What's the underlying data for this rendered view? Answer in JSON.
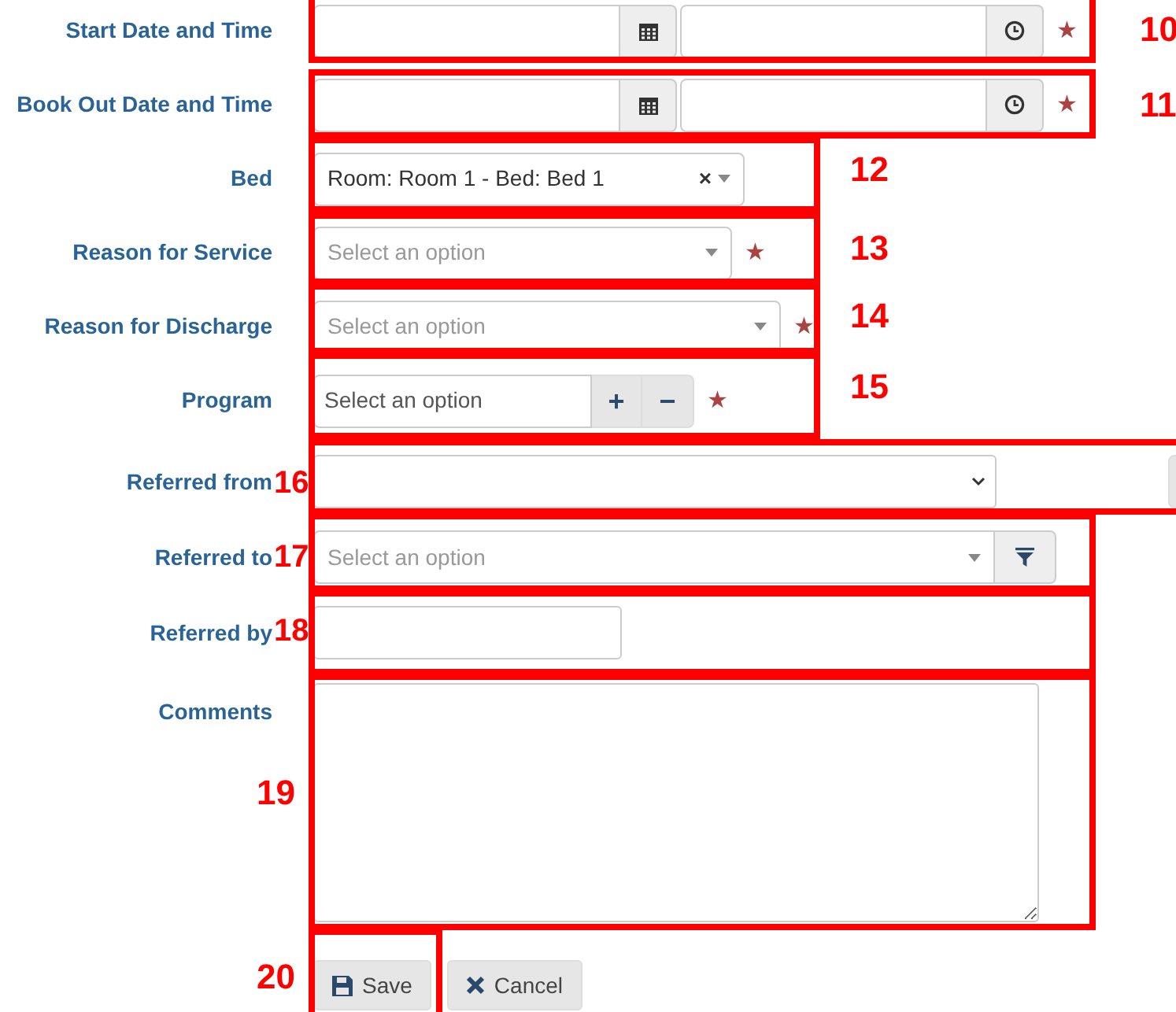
{
  "fields": [
    {
      "kind": "datetime",
      "label": "Start Date and Time",
      "required_mark": "★"
    },
    {
      "kind": "datetime",
      "label": "Book Out Date and Time",
      "required_mark": "★"
    },
    {
      "kind": "select",
      "label": "Bed",
      "value": "Room: Room 1 - Bed: Bed 1",
      "clear": "×"
    },
    {
      "kind": "select",
      "label": "Reason for Service",
      "placeholder": "Select an option",
      "required_mark": "★"
    },
    {
      "kind": "select",
      "label": "Reason for Discharge",
      "placeholder": "Select an option",
      "required_mark": "★"
    },
    {
      "kind": "program",
      "label": "Program",
      "placeholder": "Select an option",
      "add": "+",
      "remove": "−",
      "required_mark": "★"
    },
    {
      "kind": "native",
      "label": "Referred from"
    },
    {
      "kind": "filter",
      "label": "Referred to",
      "placeholder": "Select an option"
    },
    {
      "kind": "text",
      "label": "Referred by"
    },
    {
      "kind": "textarea",
      "label": "Comments"
    }
  ],
  "buttons": [
    {
      "kind": "save",
      "label": "Save"
    },
    {
      "kind": "cancel",
      "label": "Cancel"
    }
  ],
  "annotations": [
    {
      "number": "10"
    },
    {
      "number": "11"
    },
    {
      "number": "12"
    },
    {
      "number": "13"
    },
    {
      "number": "14"
    },
    {
      "number": "15"
    },
    {
      "number": "16"
    },
    {
      "number": "17"
    },
    {
      "number": "18"
    },
    {
      "number": "19"
    },
    {
      "number": "20"
    }
  ]
}
